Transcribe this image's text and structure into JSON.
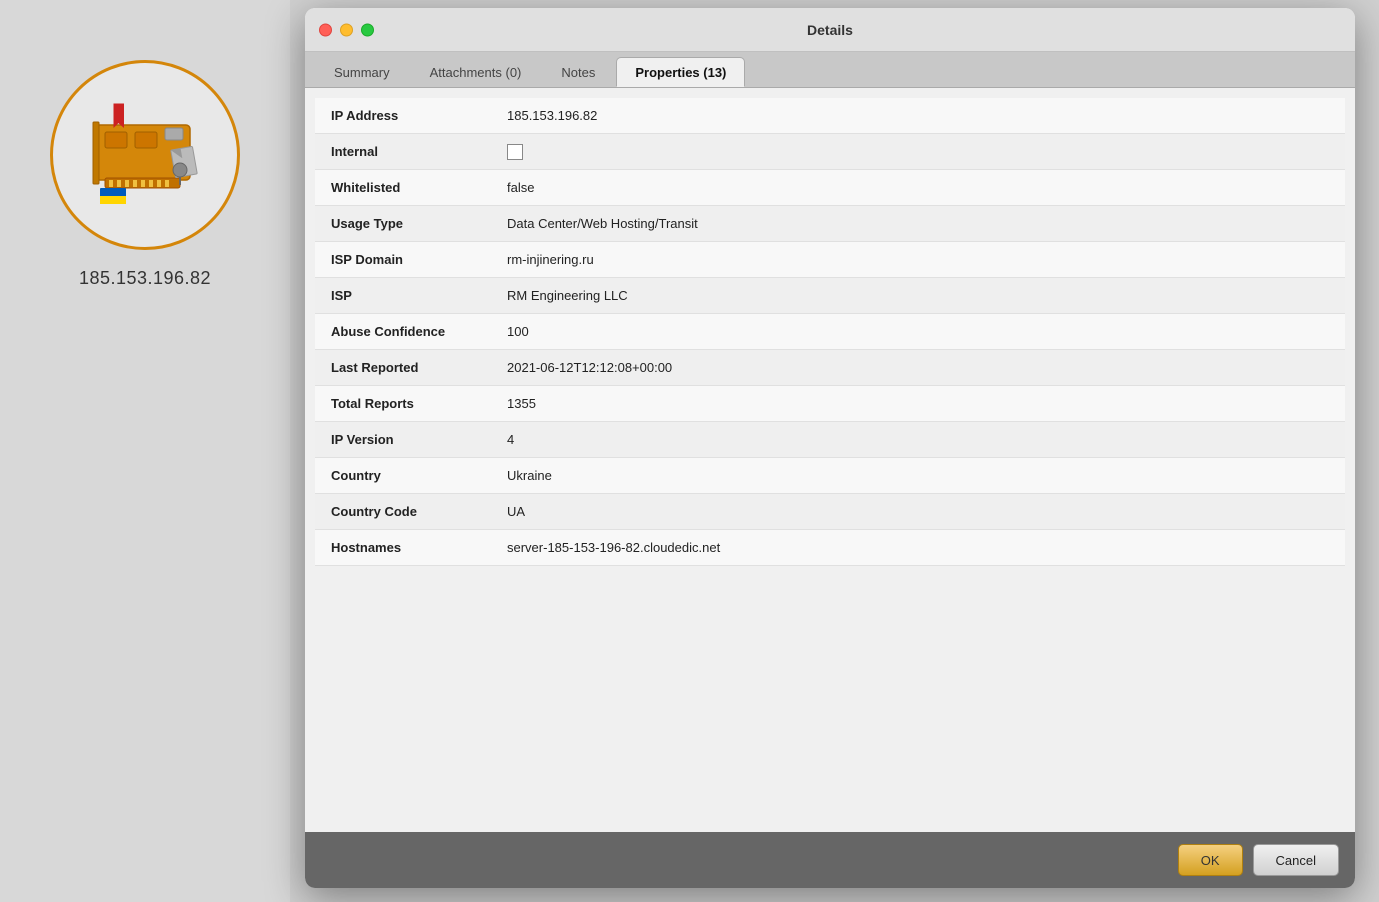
{
  "window": {
    "title": "Details"
  },
  "sidebar": {
    "ip_address": "185.153.196.82"
  },
  "tabs": [
    {
      "id": "summary",
      "label": "Summary",
      "active": false
    },
    {
      "id": "attachments",
      "label": "Attachments (0)",
      "active": false
    },
    {
      "id": "notes",
      "label": "Notes",
      "active": false
    },
    {
      "id": "properties",
      "label": "Properties (13)",
      "active": true
    }
  ],
  "properties": [
    {
      "key": "IP Address",
      "value": "185.153.196.82",
      "type": "text"
    },
    {
      "key": "Internal",
      "value": "",
      "type": "checkbox"
    },
    {
      "key": "Whitelisted",
      "value": "false",
      "type": "text"
    },
    {
      "key": "Usage Type",
      "value": "Data Center/Web Hosting/Transit",
      "type": "text"
    },
    {
      "key": "ISP Domain",
      "value": "rm-injinering.ru",
      "type": "text"
    },
    {
      "key": "ISP",
      "value": "RM Engineering LLC",
      "type": "text"
    },
    {
      "key": "Abuse Confidence",
      "value": "100",
      "type": "text"
    },
    {
      "key": "Last Reported",
      "value": "2021-06-12T12:12:08+00:00",
      "type": "text"
    },
    {
      "key": "Total Reports",
      "value": "1355",
      "type": "text"
    },
    {
      "key": "IP Version",
      "value": "4",
      "type": "text"
    },
    {
      "key": "Country",
      "value": "Ukraine",
      "type": "text"
    },
    {
      "key": "Country Code",
      "value": "UA",
      "type": "text"
    },
    {
      "key": "Hostnames",
      "value": "server-185-153-196-82.cloudedic.net",
      "type": "text"
    }
  ],
  "buttons": {
    "ok": "OK",
    "cancel": "Cancel"
  }
}
